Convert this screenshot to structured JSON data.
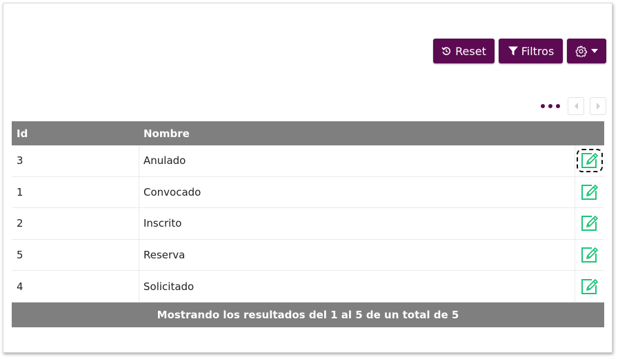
{
  "toolbar": {
    "reset_label": "Reset",
    "filtros_label": "Filtros"
  },
  "table": {
    "headers": {
      "id": "Id",
      "nombre": "Nombre"
    },
    "rows": [
      {
        "id": "3",
        "nombre": "Anulado"
      },
      {
        "id": "1",
        "nombre": "Convocado"
      },
      {
        "id": "2",
        "nombre": "Inscrito"
      },
      {
        "id": "5",
        "nombre": "Reserva"
      },
      {
        "id": "4",
        "nombre": "Solicitado"
      }
    ],
    "footer": "Mostrando los resultados del 1 al 5 de un total de 5"
  },
  "colors": {
    "primary": "#5c0b52",
    "header_bg": "#7f7f7f",
    "edit_icon": "#21c27a"
  },
  "icons": {
    "reset": "reset-icon",
    "filter": "filter-icon",
    "settings": "gear-icon",
    "dropdown": "caret-down-icon",
    "more": "more-dots-icon",
    "prev": "chevron-left-icon",
    "next": "chevron-right-icon",
    "edit": "edit-icon"
  }
}
